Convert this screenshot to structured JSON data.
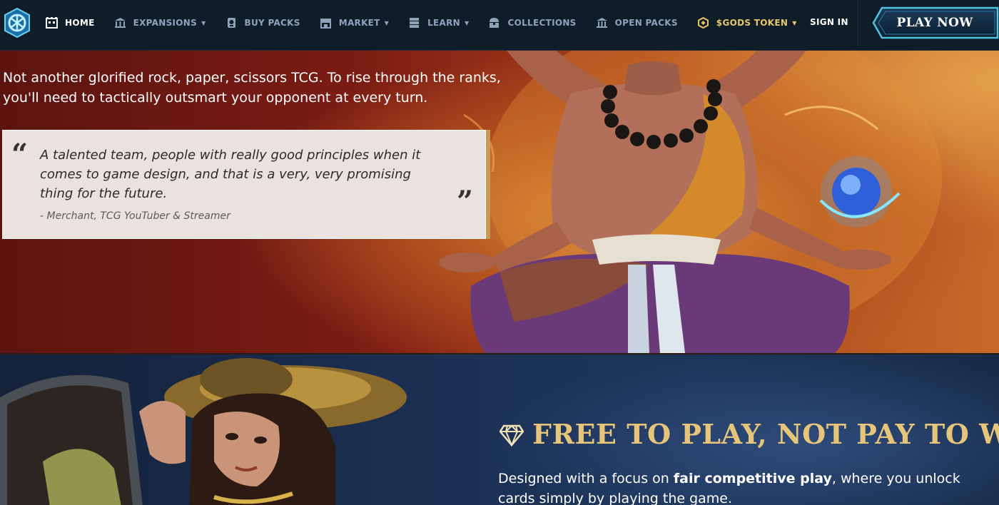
{
  "nav": {
    "items": [
      {
        "label": "HOME",
        "icon": "home-icon",
        "dropdown": false,
        "active": true
      },
      {
        "label": "EXPANSIONS",
        "icon": "temple-icon",
        "dropdown": true
      },
      {
        "label": "BUY PACKS",
        "icon": "pack-icon",
        "dropdown": false
      },
      {
        "label": "MARKET",
        "icon": "market-icon",
        "dropdown": true
      },
      {
        "label": "LEARN",
        "icon": "book-icon",
        "dropdown": true
      },
      {
        "label": "COLLECTIONS",
        "icon": "chest-icon",
        "dropdown": false
      },
      {
        "label": "OPEN PACKS",
        "icon": "bank-icon",
        "dropdown": false
      },
      {
        "label": "$GODS TOKEN",
        "icon": "gods-token-icon",
        "dropdown": true,
        "gold": true
      }
    ],
    "sign_in": "SIGN IN",
    "play_now": "PLAY NOW"
  },
  "hero1": {
    "intro": "Not another glorified rock, paper, scissors TCG. To rise through the ranks, you'll need to tactically outsmart your opponent at every turn.",
    "quote": {
      "open_mark": "“",
      "close_mark": "”",
      "text": "A talented team, people with really good principles when it comes to game design, and that is a very, very promising thing for the future.",
      "author": "- Merchant, TCG YouTuber & Streamer"
    }
  },
  "hero2": {
    "title": "FREE TO PLAY, NOT PAY TO WIN",
    "icon": "diamond-icon",
    "desc_before": "Designed with a focus on ",
    "desc_bold": "fair competitive play",
    "desc_after": ", where you unlock cards simply by playing the game."
  },
  "colors": {
    "nav_bg": "#0f1d29",
    "nav_text": "#8ea3b8",
    "gold": "#e6c57a",
    "play_button_border": "#4ec3e0"
  }
}
